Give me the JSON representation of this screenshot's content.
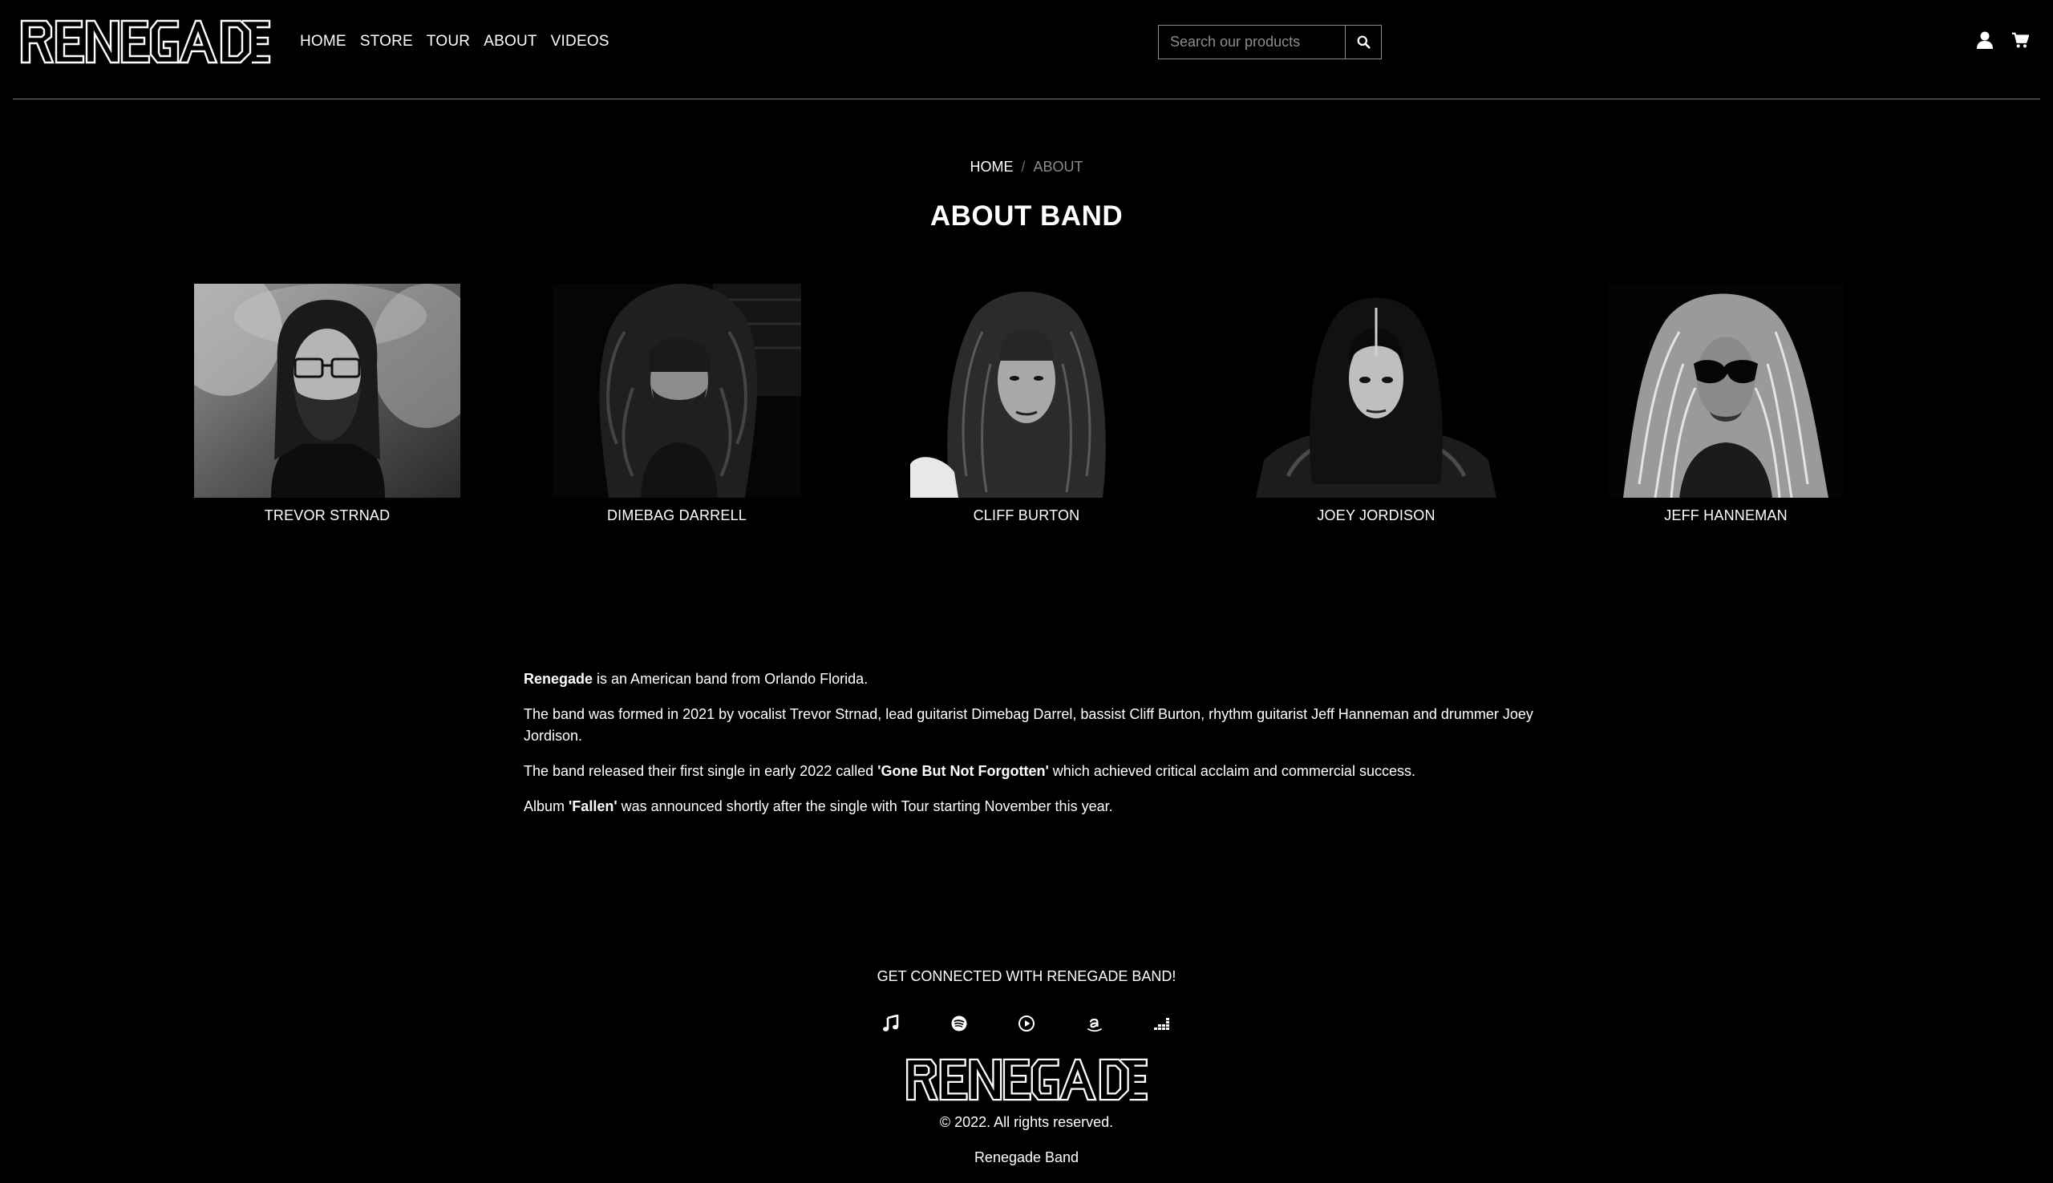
{
  "brand": {
    "logo_text": "RENEGADE",
    "logo_alt": "Renegade logo"
  },
  "nav": {
    "items": [
      {
        "label": "HOME"
      },
      {
        "label": "STORE"
      },
      {
        "label": "TOUR"
      },
      {
        "label": "ABOUT"
      },
      {
        "label": "VIDEOS"
      }
    ]
  },
  "search": {
    "placeholder": "Search our products",
    "value": "",
    "button_icon": "search-icon"
  },
  "header_icons": [
    "user-icon",
    "cart-icon"
  ],
  "breadcrumb": {
    "home": "HOME",
    "separator": "/",
    "current": "ABOUT"
  },
  "page_title": "ABOUT BAND",
  "members": [
    {
      "name": "TREVOR STRNAD"
    },
    {
      "name": "DIMEBAG DARRELL"
    },
    {
      "name": "CLIFF BURTON"
    },
    {
      "name": "JOEY JORDISON"
    },
    {
      "name": "JEFF HANNEMAN"
    }
  ],
  "about": {
    "p1_bold": "Renegade",
    "p1_rest": " is an American band from Orlando Florida.",
    "p2": "The band was formed in 2021 by vocalist Trevor Strnad, lead guitarist Dimebag Darrel, bassist Cliff Burton, rhythm guitarist Jeff Hanneman and drummer Joey Jordison.",
    "p3_before": "The band released their first single in early 2022 called ",
    "p3_bold": "'Gone But Not Forgotten'",
    "p3_after": " which achieved critical acclaim and commercial success.",
    "p4_before": "Album ",
    "p4_bold": "'Fallen'",
    "p4_after": " was announced shortly after the single with Tour starting November this year."
  },
  "footer": {
    "heading": "GET CONNECTED WITH RENEGADE BAND!",
    "social_icons": [
      "music-note-icon",
      "spotify-icon",
      "play-circle-icon",
      "amazon-icon",
      "deezer-icon"
    ],
    "copyright": "© 2022. All rights reserved.",
    "company": "Renegade Band"
  },
  "colors": {
    "background": "#000000",
    "text": "#ffffff",
    "muted": "#8a8a8a",
    "border": "#7b7b7b"
  }
}
